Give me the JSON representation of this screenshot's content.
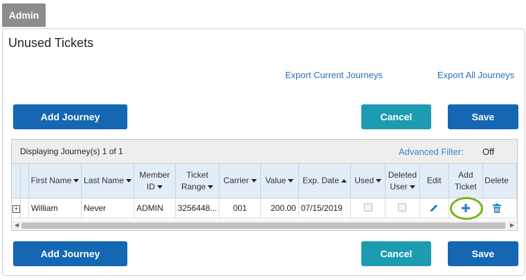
{
  "tab": {
    "label": "Admin"
  },
  "panel": {
    "title": "Unused Tickets"
  },
  "links": {
    "export_current": "Export Current Journeys",
    "export_all": "Export All Journeys"
  },
  "buttons": {
    "add_journey": "Add Journey",
    "cancel": "Cancel",
    "save": "Save"
  },
  "grid": {
    "displaying": "Displaying Journey(s) 1 of 1",
    "advanced_filter_label": "Advanced Filter:",
    "advanced_filter_value": "Off",
    "headers": {
      "first_name": "First Name",
      "last_name": "Last Name",
      "member_id_1": "Member",
      "member_id_2": "ID",
      "ticket_range_1": "Ticket",
      "ticket_range_2": "Range",
      "carrier": "Carrier",
      "value": "Value",
      "exp_date": "Exp. Date",
      "used": "Used",
      "deleted_user_1": "Deleted",
      "deleted_user_2": "User",
      "edit": "Edit",
      "add_ticket_1": "Add",
      "add_ticket_2": "Ticket",
      "delete": "Delete"
    },
    "rows": [
      {
        "expand": "+",
        "first_name": "William",
        "last_name": "Never",
        "member_id": "ADMIN",
        "ticket_range": "3256448...",
        "carrier": "001",
        "value": "200.00",
        "exp_date": "07/15/2019"
      }
    ]
  },
  "colors": {
    "primary_button": "#1567b4",
    "cancel_button": "#1d9bb0",
    "link": "#2a72b5",
    "highlight": "#7ab51d"
  }
}
